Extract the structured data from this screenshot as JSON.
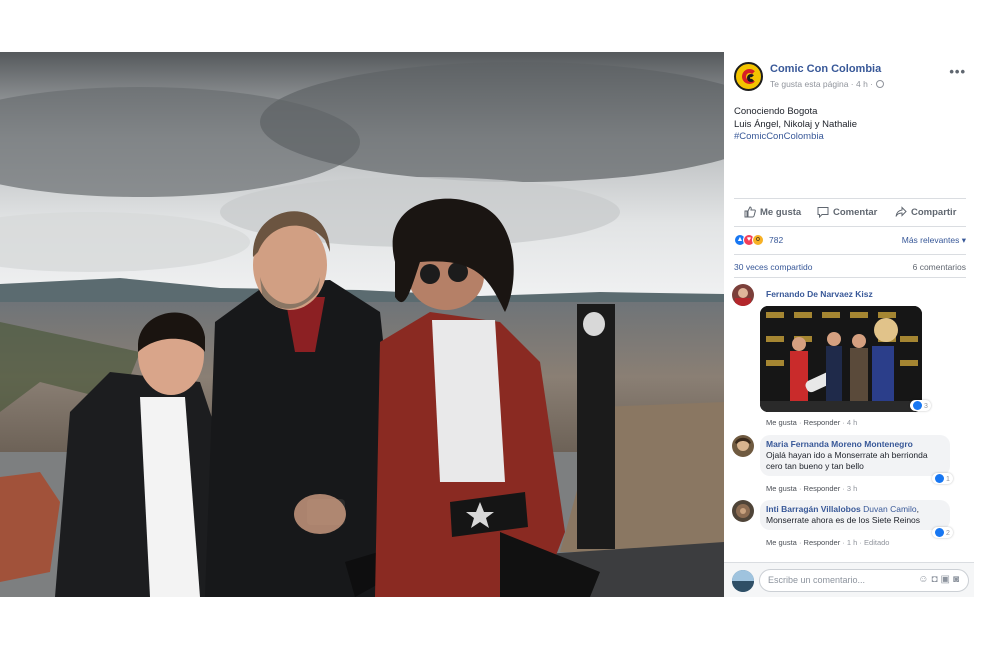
{
  "post": {
    "page_name": "Comic Con Colombia",
    "page_meta": "Te gusta esta página · 4 h ·",
    "more_label": "•••",
    "text_line1": "Conociendo Bogota",
    "text_line2": "Luis Ángel, Nikolaj y Nathalie",
    "hashtag": "#ComicConColombia"
  },
  "actions": {
    "like": "Me gusta",
    "comment": "Comentar",
    "share": "Compartir"
  },
  "reactions": {
    "count": "782",
    "relevance": "Más relevantes ▾",
    "shares": "30 veces compartido",
    "comments_count": "6 comentarios",
    "icons": [
      "like-icon",
      "love-icon",
      "wow-icon"
    ]
  },
  "comments": [
    {
      "author": "Fernando De Narvaez Kisz",
      "text": "",
      "like_label": "Me gusta",
      "reply_label": "Responder",
      "time": "4 h",
      "likes": "3",
      "has_photo": true
    },
    {
      "author": "Maria Fernanda Moreno Montenegro",
      "text": "Ojalá hayan ido a Monserrate ah berrionda cero tan bueno y tan bello",
      "like_label": "Me gusta",
      "reply_label": "Responder",
      "time": "3 h",
      "likes": "1"
    },
    {
      "author": "Inti Barragán Villalobos",
      "mention": "Duvan Camilo",
      "text": ", Monserrate ahora es de los Siete Reinos",
      "like_label": "Me gusta",
      "reply_label": "Responder",
      "time": "1 h",
      "edited": "Editado",
      "likes": "2"
    }
  ],
  "composer": {
    "placeholder": "Escribe un comentario...",
    "icons": [
      "emoji-icon",
      "camera-icon",
      "gif-icon",
      "sticker-icon"
    ]
  },
  "colors": {
    "link": "#385898",
    "muted": "#90949c",
    "like_blue": "#1877f2",
    "love_red": "#f33e58",
    "wow_yellow": "#f7b125"
  }
}
